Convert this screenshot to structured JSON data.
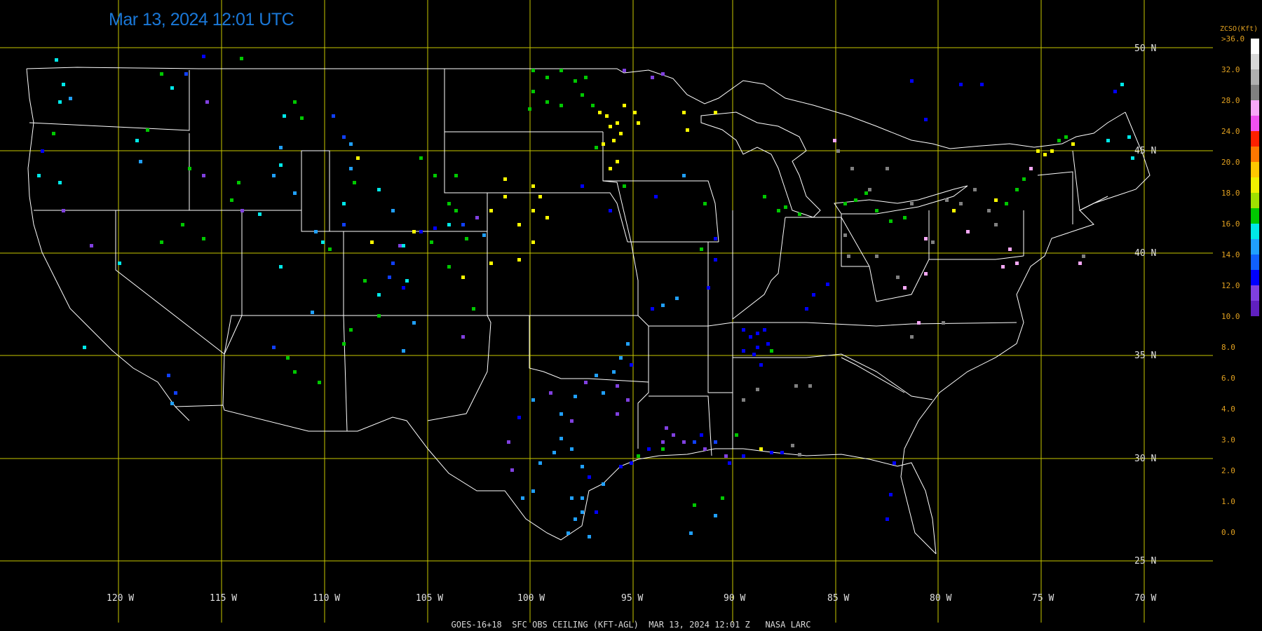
{
  "title": "Mar 13, 2024 12:01 UTC",
  "footer": "GOES-16+18  SFC OBS CEILING (KFT-AGL)  MAR 13, 2024 12:01 Z   NASA LARC",
  "latitudes": [
    "50 N",
    "45 N",
    "40 N",
    "35 N",
    "30 N",
    "25 N"
  ],
  "longitudes": [
    "120 W",
    "115 W",
    "110 W",
    "105 W",
    "100 W",
    "95 W",
    "90 W",
    "85 W",
    "80 W",
    "75 W",
    "70 W"
  ],
  "legend": {
    "title": "ZCSO(Kft)",
    "labels": [
      ">36.0",
      "32.0",
      "28.0",
      "24.0",
      "20.0",
      "18.0",
      "16.0",
      "14.0",
      "12.0",
      "10.0",
      "8.0",
      "6.0",
      "4.0",
      "3.0",
      "2.0",
      "1.0",
      "0.0"
    ],
    "colors": [
      "#ffffff",
      "#d8d8d8",
      "#b0b0b0",
      "#808080",
      "#f8a8f8",
      "#f050f0",
      "#ff2000",
      "#ff7800",
      "#ffc800",
      "#f0f000",
      "#a0e000",
      "#00c800",
      "#00e8e8",
      "#20a0ff",
      "#1060ff",
      "#0000ff",
      "#8040e0",
      "#6020c0"
    ]
  },
  "grid_color": "#c8c800",
  "boundary_color": "#ffffff"
}
